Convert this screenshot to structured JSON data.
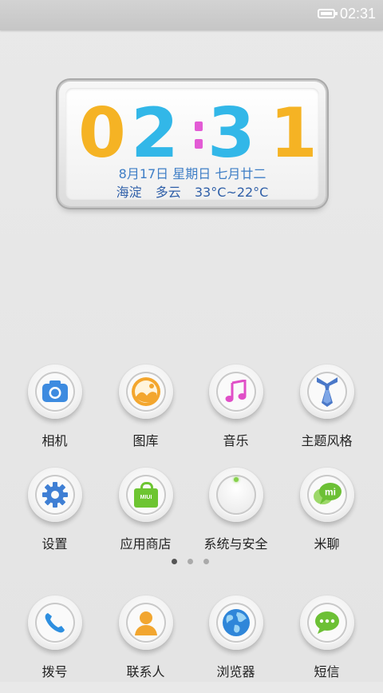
{
  "status_bar": {
    "time": "02:31",
    "battery_icon": "battery-icon"
  },
  "clock_widget": {
    "digits": [
      "0",
      "2",
      "3",
      "1"
    ],
    "date": "8月17日  星期日  七月廿二",
    "weather": {
      "location": "海淀",
      "condition": "多云",
      "temperature": "33°C~22°C"
    },
    "colors": {
      "orange": "#f5b324",
      "blue": "#32b7e8",
      "colon": "#e35bd5"
    }
  },
  "apps": [
    {
      "label": "相机",
      "icon": "camera-icon"
    },
    {
      "label": "图库",
      "icon": "gallery-icon"
    },
    {
      "label": "音乐",
      "icon": "music-icon"
    },
    {
      "label": "主题风格",
      "icon": "theme-tie-icon"
    },
    {
      "label": "设置",
      "icon": "settings-gear-icon"
    },
    {
      "label": "应用商店",
      "icon": "app-store-bag-icon"
    },
    {
      "label": "系统与安全",
      "icon": "system-security-icon"
    },
    {
      "label": "米聊",
      "icon": "mitalk-icon"
    }
  ],
  "store_bag_text": "MIUI",
  "mitalk_text": "mi",
  "page_indicator": {
    "pages": 3,
    "current": 1
  },
  "dock": [
    {
      "label": "拨号",
      "icon": "phone-icon"
    },
    {
      "label": "联系人",
      "icon": "contacts-icon"
    },
    {
      "label": "浏览器",
      "icon": "browser-globe-icon"
    },
    {
      "label": "短信",
      "icon": "messages-icon"
    }
  ]
}
